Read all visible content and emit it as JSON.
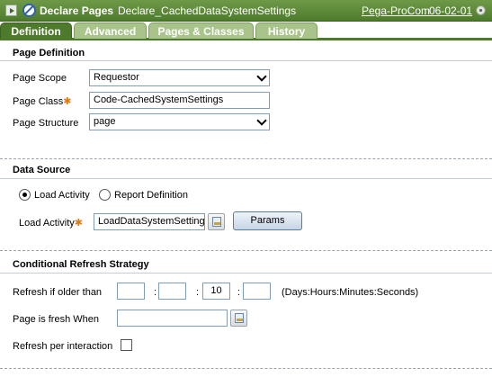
{
  "header": {
    "rule_type": "Declare Pages",
    "rule_name": "Declare_CachedDataSystemSettings",
    "ruleset": "Pega-ProCom",
    "separator": ":",
    "version": "06-02-01"
  },
  "tabs": [
    {
      "label": "Definition",
      "active": true
    },
    {
      "label": "Advanced",
      "active": false
    },
    {
      "label": "Pages & Classes",
      "active": false
    },
    {
      "label": "History",
      "active": false
    }
  ],
  "page_definition": {
    "title": "Page Definition",
    "scope_label": "Page Scope",
    "scope_value": "Requestor",
    "class_label": "Page Class",
    "class_value": "Code-CachedSystemSettings",
    "structure_label": "Page Structure",
    "structure_value": "page"
  },
  "data_source": {
    "title": "Data Source",
    "options": [
      {
        "label": "Load Activity",
        "selected": true
      },
      {
        "label": "Report Definition",
        "selected": false
      }
    ],
    "activity_label": "Load Activity",
    "activity_value": "LoadDataSystemSettings",
    "params_label": "Params"
  },
  "refresh": {
    "title": "Conditional Refresh Strategy",
    "older_than_label": "Refresh if older than",
    "days": "",
    "hours": "",
    "minutes": "10",
    "seconds": "",
    "colon": ":",
    "units_hint": "(Days:Hours:Minutes:Seconds)",
    "fresh_when_label": "Page is fresh When",
    "fresh_when_value": "",
    "per_interaction_label": "Refresh per interaction",
    "per_interaction_checked": false
  },
  "colors": {
    "header_green": "#4e7a2c",
    "tab_inactive": "#a9c48a",
    "required_star": "#e07a10"
  },
  "icons": [
    "run-icon",
    "no-entry-icon",
    "status-icon",
    "lookup-icon"
  ]
}
